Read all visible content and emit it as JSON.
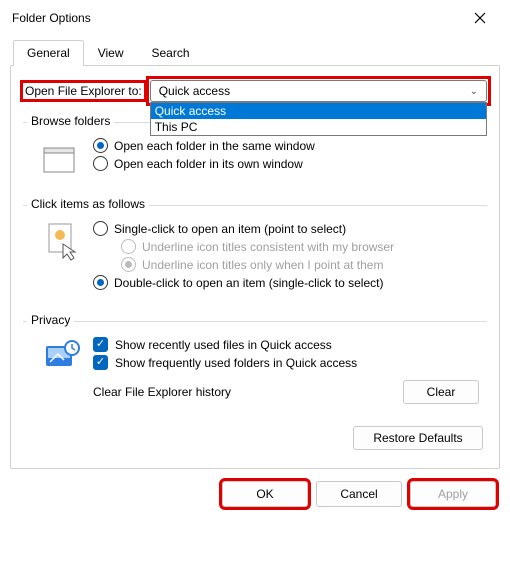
{
  "window": {
    "title": "Folder Options"
  },
  "tabs": {
    "general": "General",
    "view": "View",
    "search": "Search"
  },
  "open_explorer": {
    "label": "Open File Explorer to:",
    "selected": "Quick access",
    "options": [
      "Quick access",
      "This PC"
    ]
  },
  "browse_folders": {
    "legend": "Browse folders",
    "same_window": "Open each folder in the same window",
    "own_window": "Open each folder in its own window"
  },
  "click_items": {
    "legend": "Click items as follows",
    "single": "Single-click to open an item (point to select)",
    "underline_browser": "Underline icon titles consistent with my browser",
    "underline_point": "Underline icon titles only when I point at them",
    "double": "Double-click to open an item (single-click to select)"
  },
  "privacy": {
    "legend": "Privacy",
    "recent_files": "Show recently used files in Quick access",
    "frequent_folders": "Show frequently used folders in Quick access",
    "clear_label": "Clear File Explorer history",
    "clear_btn": "Clear"
  },
  "restore_btn": "Restore Defaults",
  "footer": {
    "ok": "OK",
    "cancel": "Cancel",
    "apply": "Apply"
  }
}
